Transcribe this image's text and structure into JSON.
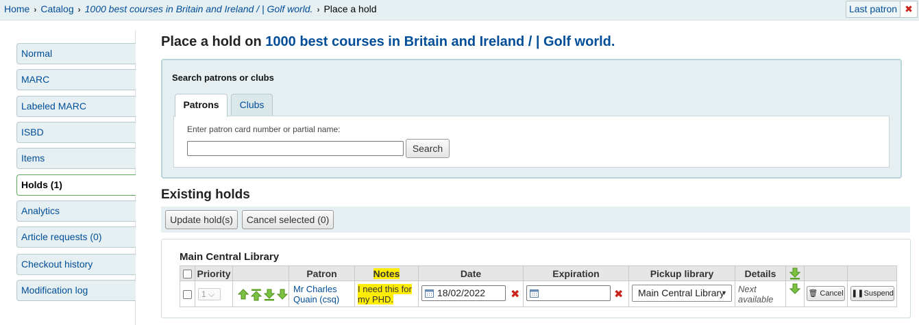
{
  "breadcrumb": {
    "home": "Home",
    "catalog": "Catalog",
    "record": "1000 best courses in Britain and Ireland / | Golf world.",
    "current": "Place a hold",
    "separator": "›"
  },
  "header": {
    "last_patron": "Last patron",
    "close_symbol": "✖"
  },
  "sidebar": {
    "items": [
      {
        "label": "Normal",
        "active": false
      },
      {
        "label": "MARC",
        "active": false
      },
      {
        "label": "Labeled MARC",
        "active": false
      },
      {
        "label": "ISBD",
        "active": false
      },
      {
        "label": "Items",
        "active": false
      },
      {
        "label": "Holds (1)",
        "active": true
      },
      {
        "label": "Analytics",
        "active": false
      },
      {
        "label": "Article requests (0)",
        "active": false
      },
      {
        "label": "Checkout history",
        "active": false
      },
      {
        "label": "Modification log",
        "active": false
      }
    ]
  },
  "main": {
    "title_prefix": "Place a hold on ",
    "title_link": "1000 best courses in Britain and Ireland / | Golf world.",
    "search": {
      "heading": "Search patrons or clubs",
      "tabs": [
        {
          "label": "Patrons"
        },
        {
          "label": "Clubs"
        }
      ],
      "label": "Enter patron card number or partial name:",
      "input_value": "",
      "button": "Search"
    },
    "existing_holds": {
      "title": "Existing holds",
      "update_button": "Update hold(s)",
      "cancel_selected_button": "Cancel selected (0)",
      "library": "Main Central Library",
      "columns": [
        "Priority",
        "Patron",
        "Notes",
        "Date",
        "Expiration",
        "Pickup library",
        "Details"
      ],
      "rows": [
        {
          "priority": "1",
          "patron_line1": "Mr Charles",
          "patron_line2": "Quain (csq)",
          "notes_line1": "I need this for",
          "notes_line2": "my PHD.",
          "date": "18/02/2022",
          "expiration": "",
          "pickup_library": "Main Central Library",
          "details_line1": "Next",
          "details_line2": "available",
          "cancel_label": "Cancel",
          "suspend_label": "Suspend"
        }
      ]
    }
  },
  "colors": {
    "link": "#004d99",
    "highlight": "#ffee00",
    "arrow": "#6ab42c",
    "delete": "#c9231c"
  }
}
